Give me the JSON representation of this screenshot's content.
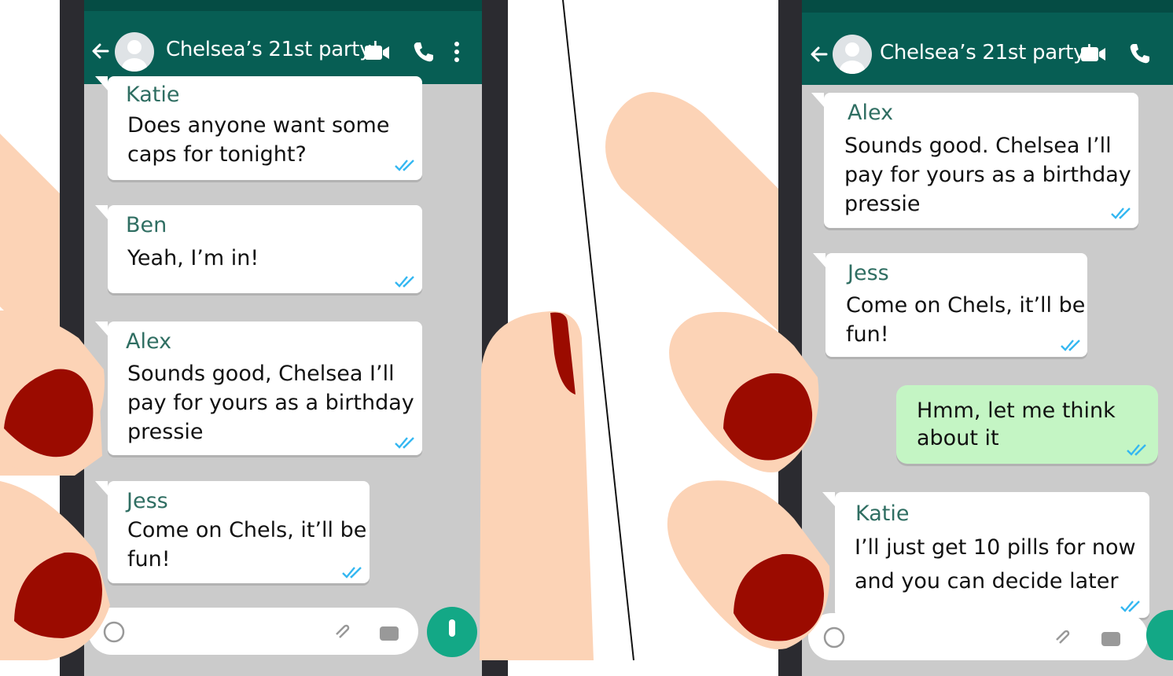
{
  "left_phone": {
    "chat_title": "Chelsea’s 21st party!",
    "messages": [
      {
        "sender": "Katie",
        "lines": [
          "Does anyone want some",
          "caps for tonight?"
        ]
      },
      {
        "sender": "Ben",
        "lines": [
          "Yeah, I’m in!"
        ]
      },
      {
        "sender": "Alex",
        "lines": [
          "Sounds good, Chelsea I’ll",
          "pay for yours as a birthday",
          "pressie"
        ]
      },
      {
        "sender": "Jess",
        "lines": [
          "Come on Chels, it’ll be",
          "fun!"
        ]
      }
    ]
  },
  "right_phone": {
    "chat_title": "Chelsea’s 21st party!",
    "messages": [
      {
        "sender": "Alex",
        "lines": [
          "Sounds good. Chelsea I’ll",
          "pay for yours as a birthday",
          "pressie"
        ]
      },
      {
        "sender": "Jess",
        "lines": [
          "Come on Chels, it’ll be",
          "fun!"
        ]
      },
      {
        "sender": "",
        "lines": [
          "Hmm, let me think",
          "about it"
        ]
      },
      {
        "sender": "Katie",
        "lines": [
          "I’ll just get 10 pills for now",
          "and you can decide later"
        ]
      }
    ]
  },
  "colors": {
    "header": "#075e54",
    "sender_name": "#2f6e62",
    "outgoing_bubble": "#c4f5c4",
    "read_ticks": "#34b7f1",
    "skin": "#fcd3b6",
    "nail": "#9b0b00"
  },
  "icons": [
    "back-arrow-icon",
    "avatar-icon",
    "video-call-icon",
    "phone-call-icon",
    "more-options-icon",
    "double-tick-icon",
    "emoji-icon",
    "attach-icon",
    "camera-icon",
    "mic-icon"
  ]
}
